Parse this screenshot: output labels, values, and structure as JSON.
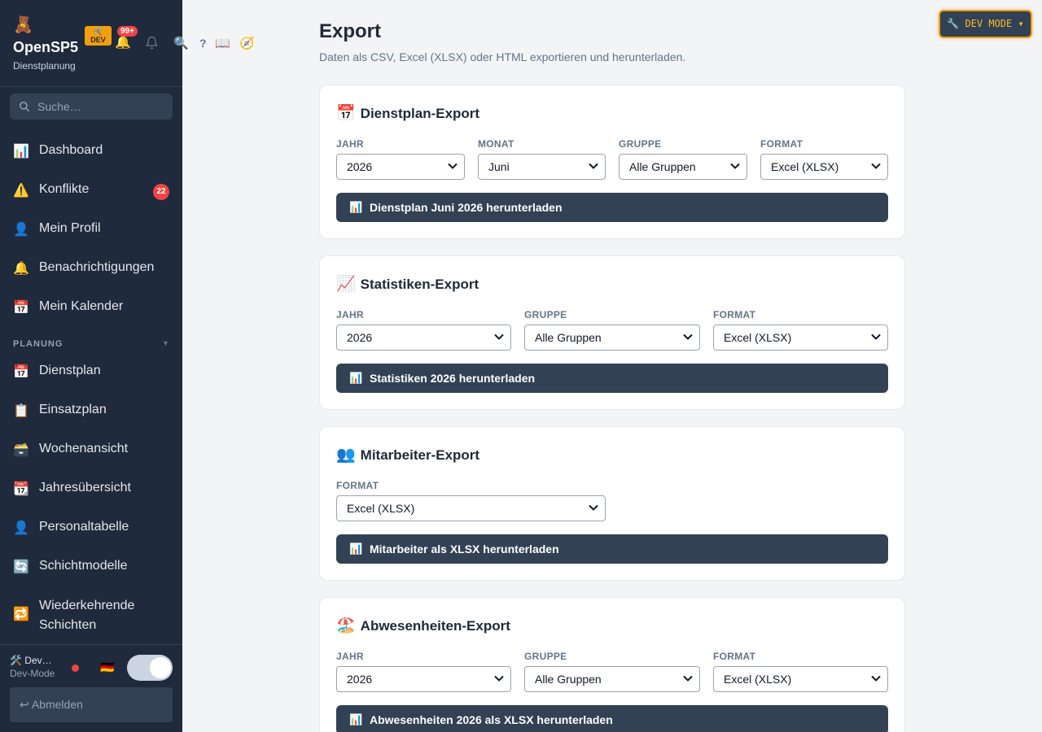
{
  "app": {
    "logo_emoji": "🧸",
    "name": "OpenSP5",
    "subtitle": "Dienstplanung",
    "dev_badge_icon": "🛠️",
    "dev_badge": "DEV",
    "notification_count": "99+"
  },
  "search": {
    "placeholder": "Suche…"
  },
  "nav": {
    "items": [
      {
        "icon": "📊",
        "label": "Dashboard"
      },
      {
        "icon": "⚠️",
        "label": "Konflikte",
        "badge": "22"
      },
      {
        "icon": "👤",
        "label": "Mein Profil"
      },
      {
        "icon": "🔔",
        "label": "Benachrichtigungen"
      },
      {
        "icon": "📅",
        "label": "Mein Kalender"
      }
    ],
    "section": "PLANUNG",
    "section_caret": "▼",
    "planning": [
      {
        "icon": "📅",
        "label": "Dienstplan"
      },
      {
        "icon": "📋",
        "label": "Einsatzplan"
      },
      {
        "icon": "🗃️",
        "label": "Wochenansicht"
      },
      {
        "icon": "📆",
        "label": "Jahresübersicht"
      },
      {
        "icon": "👤",
        "label": "Personaltabelle"
      },
      {
        "icon": "🔄",
        "label": "Schichtmodelle"
      },
      {
        "icon": "🔁",
        "label": "Wiederkehrende Schichten"
      }
    ]
  },
  "footer": {
    "user": "🛠️ Dev…",
    "role": "Dev-Mode",
    "flag": "🇩🇪",
    "logout": "↩ Abmelden"
  },
  "toolbar": {
    "search_icon": "🔍",
    "help": "?",
    "book": "📖",
    "compass": "🧭"
  },
  "devmode": {
    "label": "🔧 DEV MODE ▾"
  },
  "page": {
    "title": "Export",
    "subtitle": "Daten als CSV, Excel (XLSX) oder HTML exportieren und herunterladen."
  },
  "cards": {
    "dienstplan": {
      "icon": "📅",
      "title": "Dienstplan-Export",
      "fields": [
        {
          "label": "JAHR",
          "value": "2026"
        },
        {
          "label": "MONAT",
          "value": "Juni"
        },
        {
          "label": "GRUPPE",
          "value": "Alle Gruppen"
        },
        {
          "label": "FORMAT",
          "value": "Excel (XLSX)"
        }
      ],
      "button_icon": "📊",
      "button": "Dienstplan Juni 2026 herunterladen"
    },
    "statistiken": {
      "icon": "📈",
      "title": "Statistiken-Export",
      "fields": [
        {
          "label": "JAHR",
          "value": "2026"
        },
        {
          "label": "GRUPPE",
          "value": "Alle Gruppen"
        },
        {
          "label": "FORMAT",
          "value": "Excel (XLSX)"
        }
      ],
      "button_icon": "📊",
      "button": "Statistiken 2026 herunterladen"
    },
    "mitarbeiter": {
      "icon": "👥",
      "title": "Mitarbeiter-Export",
      "fields": [
        {
          "label": "FORMAT",
          "value": "Excel (XLSX)"
        }
      ],
      "button_icon": "📊",
      "button": "Mitarbeiter als XLSX herunterladen"
    },
    "abwesenheiten": {
      "icon": "🏖️",
      "title": "Abwesenheiten-Export",
      "fields": [
        {
          "label": "JAHR",
          "value": "2026"
        },
        {
          "label": "GRUPPE",
          "value": "Alle Gruppen"
        },
        {
          "label": "FORMAT",
          "value": "Excel (XLSX)"
        }
      ],
      "button_icon": "📊",
      "button": "Abwesenheiten 2026 als XLSX herunterladen"
    }
  },
  "colors": {
    "sidebar": "#1f2a3c",
    "button": "#334155",
    "accent": "#f59e0b",
    "danger": "#ef4444"
  }
}
